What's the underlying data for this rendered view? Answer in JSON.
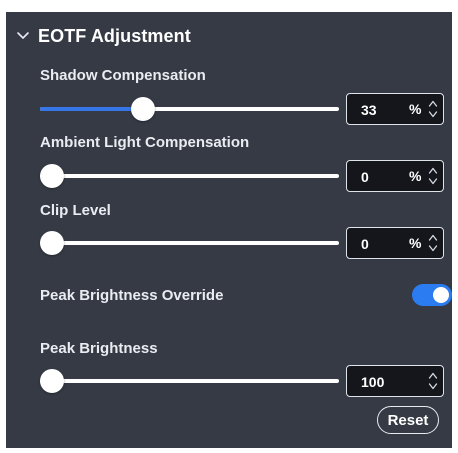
{
  "section": {
    "title": "EOTF Adjustment",
    "expanded": true,
    "chevron_icon": "chevron-down-icon"
  },
  "controls": {
    "shadow": {
      "label": "Shadow Compensation",
      "value": "33",
      "unit": "%",
      "slider_fraction": 0.33
    },
    "ambient": {
      "label": "Ambient Light Compensation",
      "value": "0",
      "unit": "%",
      "slider_fraction": 0
    },
    "clip": {
      "label": "Clip Level",
      "value": "0",
      "unit": "%",
      "slider_fraction": 0
    },
    "peak_override": {
      "label": "Peak Brightness Override",
      "enabled": true
    },
    "peak": {
      "label": "Peak Brightness",
      "value": "100",
      "unit": "",
      "slider_fraction": 0
    }
  },
  "reset_label": "Reset",
  "colors": {
    "panel_background": "#353a45",
    "accent": "#2b7cf0",
    "slider_fill": "#3776e8",
    "input_background": "#14161b"
  }
}
